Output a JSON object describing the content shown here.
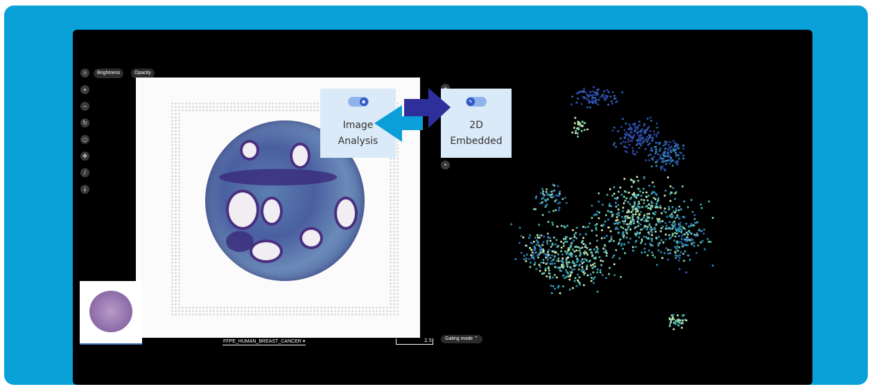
{
  "viewer": {
    "toolbar": {
      "brightness_label": "Brightness",
      "opacity_label": "Opacity"
    },
    "left_tools": [
      "location-pin-icon",
      "zoom-in-icon",
      "zoom-out-icon",
      "rotate-icon",
      "lasso-icon",
      "pointer-icon",
      "ruler-icon",
      "download-icon"
    ],
    "dataset_label": "FFPE_HUMAN_BREAST_CANCER ▾",
    "scale_value": "2.5",
    "gating_label": "Gating mode ⌃",
    "right_tools": [
      "zoom-in-icon"
    ]
  },
  "callouts": {
    "image_analysis": {
      "line1": "Image",
      "line2": "Analysis"
    },
    "embedded": {
      "line1": "2D",
      "line2": "Embedded"
    }
  },
  "colors": {
    "frame": "#0aa0d8",
    "screen": "#000000",
    "card_bg": "#dbeaf8",
    "arrow_left": "#0a9fd8",
    "arrow_right": "#2e2f9a",
    "cluster_palette": [
      "#2a3f9e",
      "#2f5fae",
      "#2e86b0",
      "#3aa8b0",
      "#7fd0b0",
      "#cde8a8"
    ]
  }
}
